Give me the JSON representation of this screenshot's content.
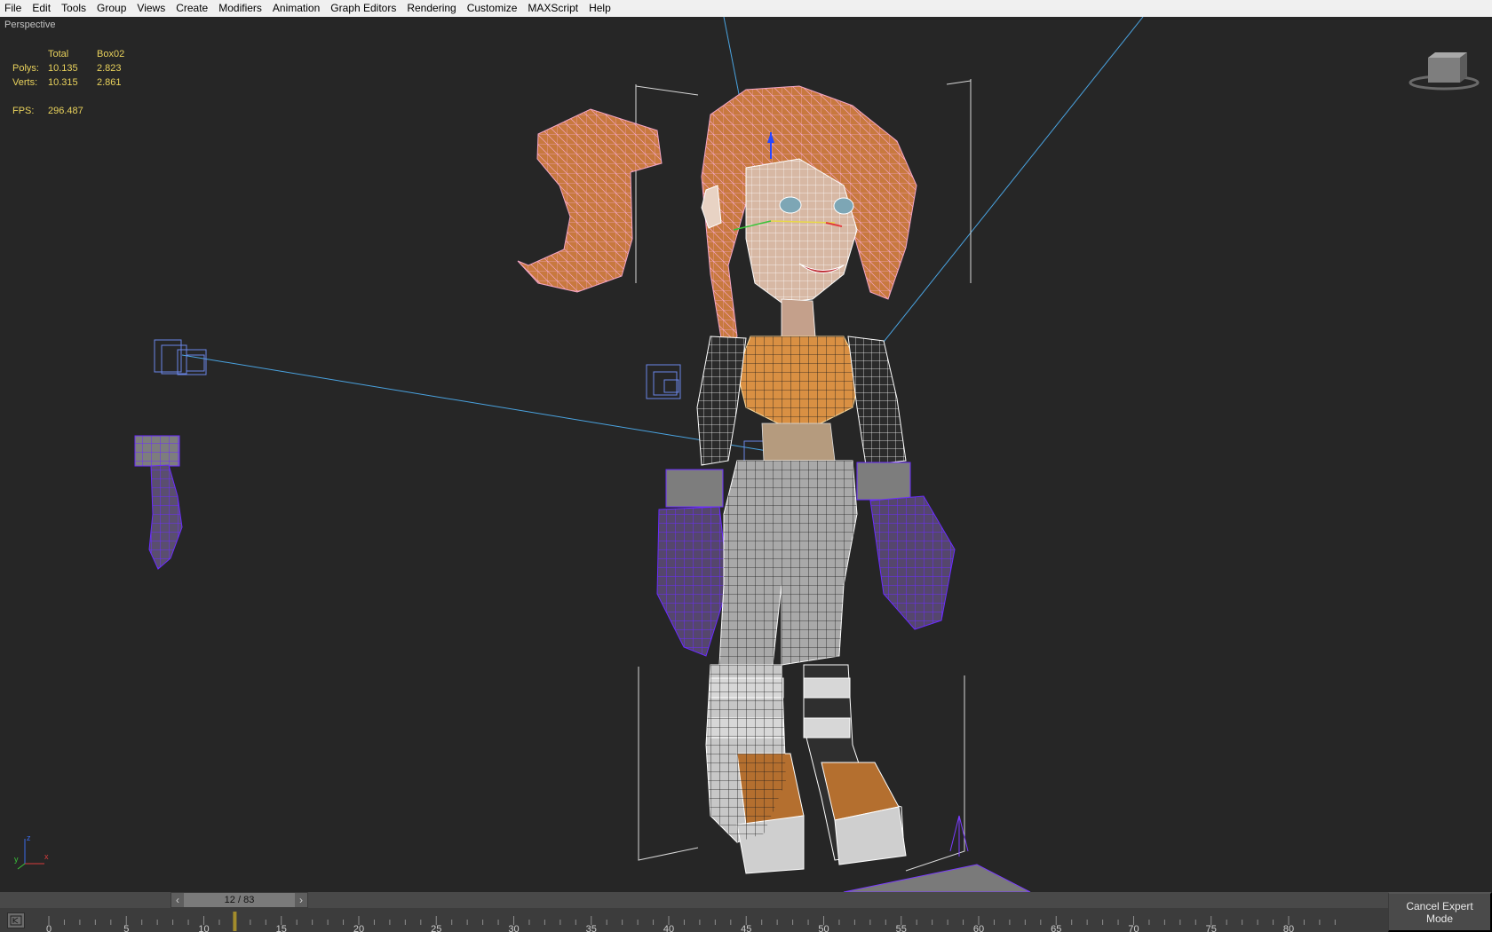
{
  "menu": [
    "File",
    "Edit",
    "Tools",
    "Group",
    "Views",
    "Create",
    "Modifiers",
    "Animation",
    "Graph Editors",
    "Rendering",
    "Customize",
    "MAXScript",
    "Help"
  ],
  "viewport": {
    "label": "Perspective",
    "stats": {
      "header_total": "Total",
      "header_object": "Box02",
      "polys_label": "Polys:",
      "polys_total": "10.135",
      "polys_object": "2.823",
      "verts_label": "Verts:",
      "verts_total": "10.315",
      "verts_object": "2.861",
      "fps_label": "FPS:",
      "fps_value": "296.487"
    },
    "axis_x": "x",
    "axis_y": "y",
    "axis_z": "z"
  },
  "timeline": {
    "slider_value": "12 / 83",
    "prev_icon": "chevron-left-icon",
    "next_icon": "chevron-right-icon",
    "ruler_ticks": [
      "0",
      "5",
      "10",
      "15",
      "20",
      "25",
      "30",
      "35",
      "40",
      "45",
      "50",
      "55",
      "60",
      "65",
      "70",
      "75",
      "80"
    ],
    "current_frame": 12,
    "total_frames": 83
  },
  "status": {
    "expert_button": "Cancel Expert Mode"
  },
  "colors": {
    "stats_text": "#e9d25c",
    "viewport_bg": "#262626",
    "link_line": "#4aa3e0",
    "selection_wire": "#7a3cff"
  }
}
